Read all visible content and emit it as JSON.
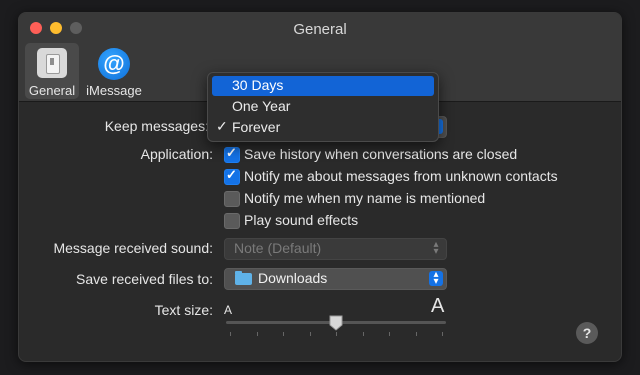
{
  "window": {
    "title": "General"
  },
  "toolbar": {
    "tabs": [
      {
        "label": "General",
        "icon": "general-switch-icon",
        "selected": true
      },
      {
        "label": "iMessage",
        "icon": "at-sign-icon",
        "selected": false
      }
    ]
  },
  "settings": {
    "keep_messages": {
      "label": "Keep messages:",
      "menu": {
        "options": [
          "30 Days",
          "One Year",
          "Forever"
        ],
        "highlighted": "30 Days",
        "checked": "Forever",
        "check_glyph": "✓"
      }
    },
    "application": {
      "label": "Application:",
      "checkboxes": [
        {
          "label": "Save history when conversations are closed",
          "checked": true
        },
        {
          "label": "Notify me about messages from unknown contacts",
          "checked": true
        },
        {
          "label": "Notify me when my name is mentioned",
          "checked": false
        },
        {
          "label": "Play sound effects",
          "checked": false
        }
      ]
    },
    "message_sound": {
      "label": "Message received sound:",
      "value": "Note (Default)",
      "disabled": true
    },
    "save_files": {
      "label": "Save received files to:",
      "value": "Downloads",
      "icon": "folder-icon"
    },
    "text_size": {
      "label": "Text size:",
      "small_glyph": "A",
      "large_glyph": "A",
      "level_fraction": 0.5,
      "ticks": 9
    }
  },
  "help_button": {
    "glyph": "?"
  },
  "colors": {
    "accent": "#1472e6",
    "window_bg": "#2a2a2a",
    "titlebar_bg": "#393939",
    "close": "#fe5f57",
    "minimize": "#febc2e"
  }
}
